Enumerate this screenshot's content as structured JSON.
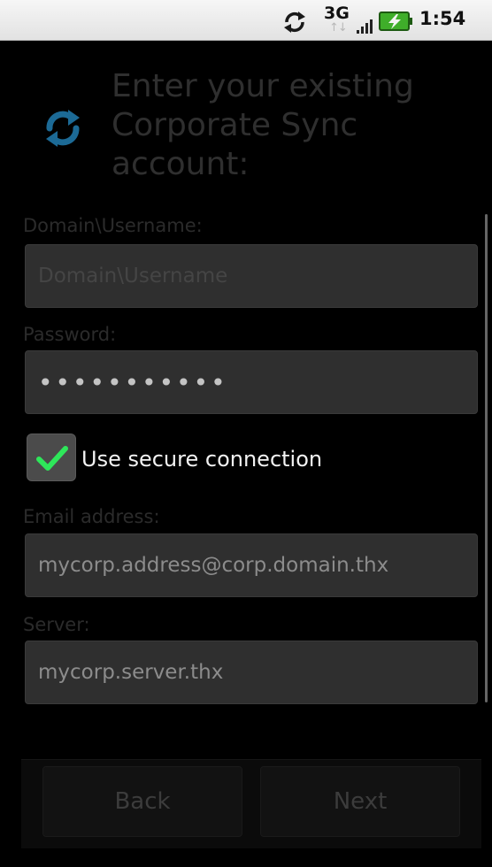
{
  "status_bar": {
    "network_type": "3G",
    "network_activity": "↑↓",
    "time": "1:54",
    "icons": [
      "sync-icon",
      "signal-strength-icon",
      "battery-charging-icon"
    ]
  },
  "header": {
    "icon": "corporate-sync-icon",
    "title": "Enter your existing Corporate Sync account:"
  },
  "form": {
    "domain_username": {
      "label": "Domain\\Username:",
      "placeholder": "Domain\\Username",
      "value": ""
    },
    "password": {
      "label": "Password:",
      "value_masked": "•••••••••••"
    },
    "secure_connection": {
      "label": "Use secure connection",
      "checked": true
    },
    "email": {
      "label": "Email address:",
      "value": "mycorp.address@corp.domain.thx"
    },
    "server": {
      "label": "Server:",
      "value": "mycorp.server.thx"
    }
  },
  "buttons": {
    "back": "Back",
    "next": "Next"
  },
  "colors": {
    "background": "#000000",
    "field_background": "#2f2f2f",
    "checkmark": "#2ee65a",
    "sync_icon": "#1c6a96"
  }
}
